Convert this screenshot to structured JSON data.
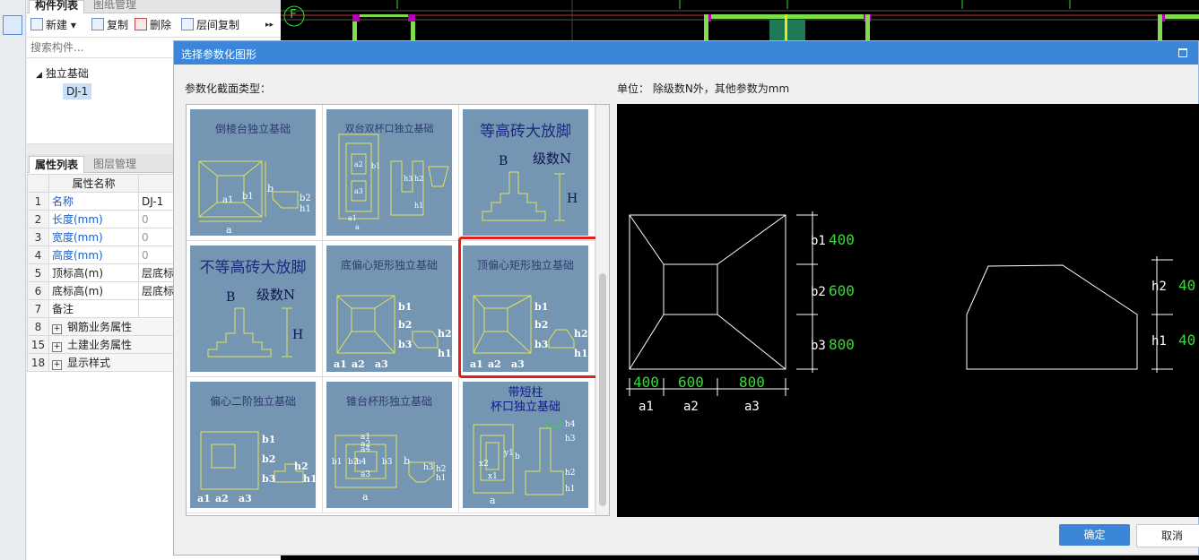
{
  "left_panel": {
    "tabs": [
      "构件列表",
      "图纸管理"
    ],
    "toolbar": {
      "new": "新建",
      "copy": "复制",
      "delete": "删除",
      "floor_copy": "层间复制",
      "more": "▸▸"
    },
    "search_placeholder": "搜索构件...",
    "tree": {
      "group": "独立基础",
      "item": "DJ-1"
    }
  },
  "props_panel": {
    "tabs": [
      "属性列表",
      "图层管理"
    ],
    "header": "属性名称",
    "rows": [
      {
        "num": "1",
        "name": "名称",
        "value": "DJ-1"
      },
      {
        "num": "2",
        "name": "长度(mm)",
        "value": "0"
      },
      {
        "num": "3",
        "name": "宽度(mm)",
        "value": "0"
      },
      {
        "num": "4",
        "name": "高度(mm)",
        "value": "0"
      },
      {
        "num": "5",
        "name": "顶标高(m)",
        "value": "层底标"
      },
      {
        "num": "6",
        "name": "底标高(m)",
        "value": "层底标"
      },
      {
        "num": "7",
        "name": "备注",
        "value": ""
      },
      {
        "num": "8",
        "name": "钢筋业务属性",
        "value": ""
      },
      {
        "num": "15",
        "name": "土建业务属性",
        "value": ""
      },
      {
        "num": "18",
        "name": "显示样式",
        "value": ""
      }
    ]
  },
  "cad": {
    "axis_label": "F"
  },
  "dialog": {
    "title": "选择参数化图形",
    "section_label": "参数化截面类型：",
    "unit_label": "单位：  除级数N外，其他参数为mm",
    "ok": "确定",
    "cancel": "取消"
  },
  "gallery": [
    {
      "title": "倒棱台独立基础",
      "labels": [
        "a",
        "b",
        "a1",
        "b1",
        "b2",
        "h1"
      ]
    },
    {
      "title": "双台双杯口独立基础",
      "labels": [
        "a",
        "a1",
        "a2",
        "a3",
        "b1",
        "h1",
        "h2",
        "h3"
      ]
    },
    {
      "title": "等高砖大放脚",
      "labels": [
        "B",
        "级数N",
        "H"
      ]
    },
    {
      "title": "不等高砖大放脚",
      "labels": [
        "B",
        "级数N",
        "H"
      ]
    },
    {
      "title": "底偏心矩形独立基础",
      "labels": [
        "b1",
        "b2",
        "b3",
        "a1",
        "a2",
        "a3",
        "h1",
        "h2"
      ]
    },
    {
      "title": "顶偏心矩形独立基础",
      "labels": [
        "b1",
        "b2",
        "b3",
        "a1",
        "a2",
        "a3",
        "h1",
        "h2"
      ]
    },
    {
      "title": "偏心二阶独立基础",
      "labels": [
        "b1",
        "b2",
        "b3",
        "a1",
        "a2",
        "a3",
        "h1",
        "h2"
      ]
    },
    {
      "title": "锥台杯形独立基础",
      "labels": [
        "a",
        "a1",
        "a2",
        "a3",
        "a4",
        "b",
        "b1",
        "b2",
        "b3",
        "b4",
        "h1",
        "h2",
        "h3"
      ]
    },
    {
      "title_line1": "带短柱",
      "title_line2": "杯口独立基础",
      "labels": [
        "a",
        "x1",
        "x2",
        "y1",
        "b",
        "h1",
        "h2",
        "h3",
        "h4"
      ]
    }
  ],
  "selected_index": 5,
  "preview": {
    "b_labels": [
      "b1",
      "b2",
      "b3"
    ],
    "b_values": [
      "400",
      "600",
      "800"
    ],
    "a_labels": [
      "a1",
      "a2",
      "a3"
    ],
    "a_values": [
      "400",
      "600",
      "800"
    ],
    "h_labels": [
      "h2",
      "h1"
    ],
    "h_values": [
      "40",
      "40"
    ]
  },
  "colors": {
    "accent": "#3c86d9",
    "selection": "#e0201b",
    "thumb_bg": "#7596b2",
    "cad_green": "#33dd33"
  }
}
